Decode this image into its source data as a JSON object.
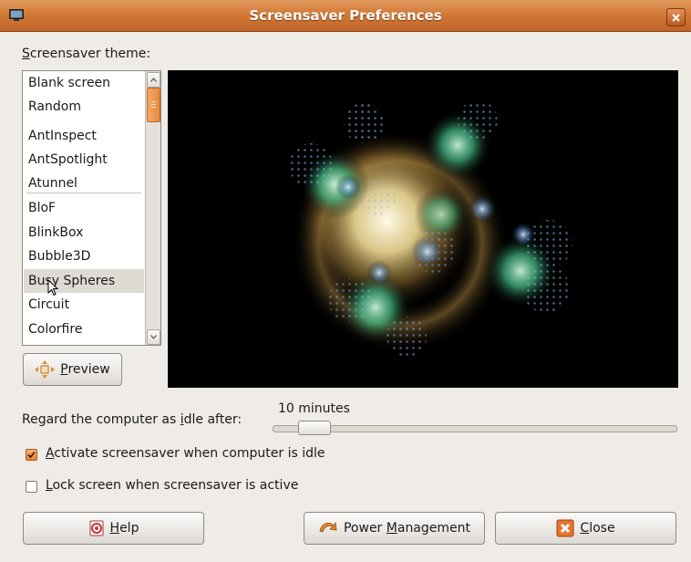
{
  "window": {
    "title": "Screensaver Preferences"
  },
  "theme_label": {
    "mnemonic": "S",
    "rest": "creensaver theme:"
  },
  "themes": {
    "items": [
      "Blank screen",
      "Random",
      "AntInspect",
      "AntSpotlight",
      "Atunnel",
      "BloF",
      "BlinkBox",
      "Bubble3D",
      "Busy Spheres",
      "Circuit",
      "Colorfire"
    ],
    "selected": "Busy Spheres"
  },
  "preview_button": {
    "mnemonic": "P",
    "rest": "review"
  },
  "idle": {
    "label_before": "Regard the computer as ",
    "label_mnemonic": "i",
    "label_after": "dle after:",
    "value": "10 minutes"
  },
  "activate_checkbox": {
    "mnemonic": "A",
    "rest": "ctivate screensaver when computer is idle",
    "checked": true
  },
  "lock_checkbox": {
    "mnemonic": "L",
    "rest": "ock screen when screensaver is active",
    "checked": false
  },
  "help_button": {
    "mnemonic": "H",
    "rest": "elp"
  },
  "power_button": {
    "before": "Power ",
    "mnemonic": "M",
    "rest": "anagement"
  },
  "close_button": {
    "mnemonic": "C",
    "rest": "lose"
  },
  "colors": {
    "titlebar": "#d27a36",
    "accent": "#e68a3e",
    "background": "#efebe7"
  },
  "icons": [
    "app-icon",
    "window-close-icon",
    "scroll-up-icon",
    "scroll-down-icon",
    "preview-icon",
    "mouse-cursor-icon",
    "help-icon",
    "power-icon",
    "close-icon",
    "checkmark-icon"
  ]
}
